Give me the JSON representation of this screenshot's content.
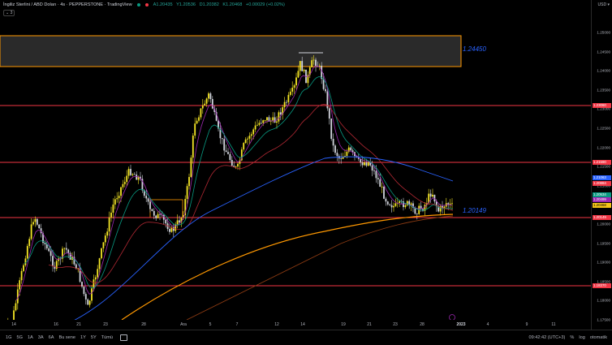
{
  "header": {
    "title": "İngiliz Sterlini / ABD Doları · 4s · PEPPERSTONE · TradingView",
    "ohlc": [
      "A1.20435",
      "Y1.20536",
      "D1.20382",
      "K1.20468",
      "+0.00029 (+0.02%)"
    ],
    "collapse_count": "3"
  },
  "price_axis": {
    "currency": "USD",
    "ticks": [
      "1.25000",
      "1.24500",
      "1.24000",
      "1.23500",
      "1.23000",
      "1.22500",
      "1.22000",
      "1.21500",
      "1.21000",
      "1.20500",
      "1.20000",
      "1.19500",
      "1.19000",
      "1.18500",
      "1.18000",
      "1.17500"
    ],
    "tags": [
      {
        "text": "1.23060",
        "color": "#f23645"
      },
      {
        "text": "1.21590",
        "color": "#f23645"
      },
      {
        "text": "1.21063",
        "color": "#2962ff"
      },
      {
        "text": "1.20884",
        "color": "#f23645"
      },
      {
        "text": "1.20534",
        "color": "#089981"
      },
      {
        "text": "1.20499",
        "color": "#9c27b0"
      },
      {
        "text": "1.20468",
        "color": "#f5c518"
      },
      {
        "text": "1.20149",
        "color": "#f23645"
      },
      {
        "text": "1.18370",
        "color": "#f23645"
      }
    ]
  },
  "levels": {
    "upper_zone_label": "1.24450",
    "support_label": "1.20149"
  },
  "time_axis": {
    "labels": [
      "14",
      "16",
      "21",
      "23",
      "28",
      "Ara",
      "5",
      "7",
      "12",
      "14",
      "19",
      "21",
      "23",
      "28",
      "2023",
      "4",
      "9",
      "11"
    ]
  },
  "bottom_bar": {
    "ranges": [
      "1G",
      "5G",
      "1A",
      "3A",
      "6A",
      "Bu sene",
      "1Y",
      "5Y",
      "Tümü"
    ],
    "clock": "09:42:42 (UTC+3)",
    "percent": "%",
    "log": "log",
    "auto": "otomatik"
  },
  "colors": {
    "up": "#f5e625",
    "down": "#d1d4dc",
    "level": "#f23645",
    "zone_border": "#ff9800",
    "ma_fast": "#9c27b0",
    "ma_green": "#089981",
    "ma_red": "#b22833",
    "ma_blue": "#2962ff",
    "ma_orange": "#ff9800"
  }
}
